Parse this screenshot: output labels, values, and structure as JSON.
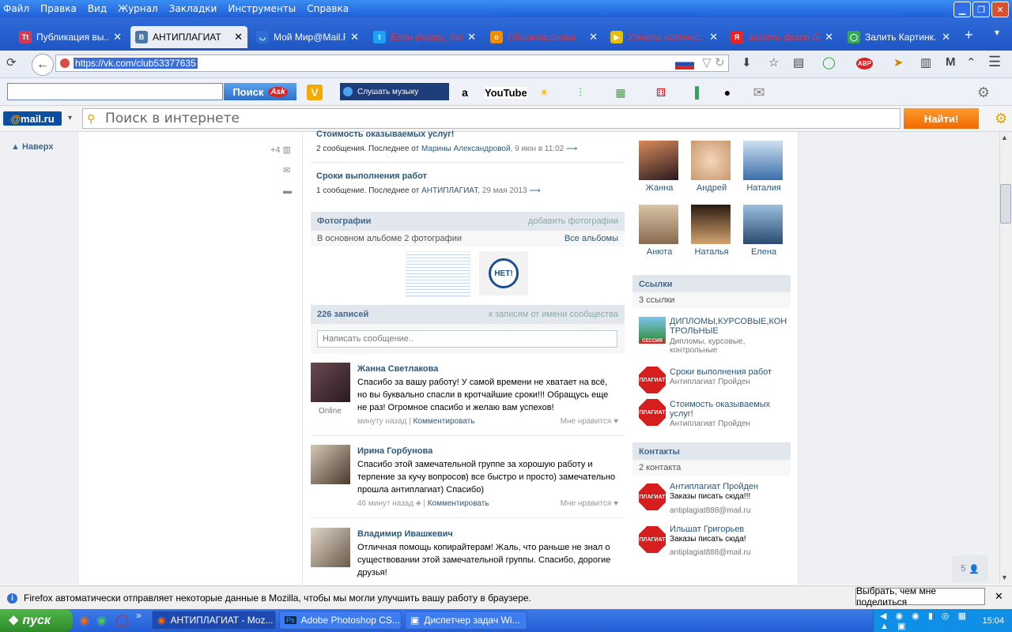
{
  "browser": {
    "menu": [
      "Файл",
      "Правка",
      "Вид",
      "Журнал",
      "Закладки",
      "Инструменты",
      "Справка"
    ],
    "tabs": [
      {
        "label": "Публикация вы...",
        "fav_text": "Tt",
        "fav_color": "#d43a5a",
        "active": false,
        "red": false
      },
      {
        "label": "АНТИПЛАГИАТ",
        "fav_text": "В",
        "fav_color": "#4a76a8",
        "active": true,
        "red": false
      },
      {
        "label": "Мой Мир@Mail.Ru",
        "fav_text": "◡",
        "fav_color": "#2a6fd1",
        "active": false,
        "red": false
      },
      {
        "label": "Елен (happy_mu...",
        "fav_text": "t",
        "fav_color": "#1da1f2",
        "active": false,
        "red": true
      },
      {
        "label": "Одноклассники",
        "fav_text": "о",
        "fav_color": "#f28b00",
        "active": false,
        "red": true
      },
      {
        "label": "Узнать количес...",
        "fav_text": "▶",
        "fav_color": "#e6c000",
        "active": false,
        "red": true
      },
      {
        "label": "залить фото бе...",
        "fav_text": "Я",
        "fav_color": "#e82525",
        "active": false,
        "red": true
      },
      {
        "label": "Залить Картинк...",
        "fav_text": "◯",
        "fav_color": "#34a853",
        "active": false,
        "red": false
      }
    ],
    "url": "https://vk.com/club53377635",
    "ask_button": "Поиск",
    "ask_logo": "Ask",
    "music_button": "Слушать музыку",
    "youtube": "YouTube",
    "mailru_logo": "mail.ru",
    "mailru_at": "@",
    "mail_search_placeholder": "Поиск в интернете",
    "find_button": "Найти!"
  },
  "page": {
    "back_to_top": "Наверх",
    "plus_count": "+4",
    "topics": [
      {
        "title": "Стоимость оказываемых услуг!",
        "count": "2 сообщения. Последнее от",
        "author": "Марины Александровой",
        "date": ", 9 июн в 11:02"
      },
      {
        "title": "Сроки выполнения работ",
        "count": "1 сообщение. Последнее от",
        "author": "АНТИПЛАГИАТ",
        "date": ", 29 мая 2013"
      }
    ],
    "photos": {
      "header": "Фотографии",
      "add": "добавить фотографии",
      "album_text": "В основном альбоме 2 фотографии",
      "all_albums": "Все альбомы",
      "badge_text": "НЕТ!"
    },
    "wall": {
      "header": "226 записей",
      "to_community": "к записям от имени сообщества",
      "placeholder": "Написать сообщение.."
    },
    "posts": [
      {
        "name": "Жанна Светлакова",
        "text": "Спасибо за вашу работу! У самой времени не хватает на всё, но вы буквально спасли в кротчайшие сроки!!! Обращусь еще не раз! Огромное спасибо и желаю вам успехов!",
        "time": "минуту назад",
        "comment": "Комментировать",
        "like": "Мне нравится",
        "status": "Online",
        "ava_color": "#3a2a30"
      },
      {
        "name": "Ирина Горбунова",
        "text": "Спасибо этой замечательной группе за хорошую работу и терпение за кучу вопросов) все быстро и просто) замечательно прошла антиплагиат) Спасибо)",
        "time": "46 минут назад",
        "comment": "Комментировать",
        "like": "Мне нравится",
        "status": "",
        "ava_color": "#5b4a3e"
      },
      {
        "name": "Владимир Ивашкевич",
        "text": "Отличная помощь копирайтерам! Жаль, что раньше не знал о существовании этой замечательной группы. Спасибо, дорогие друзья!",
        "time": "",
        "comment": "",
        "like": "",
        "status": "",
        "ava_color": "#7a6a5a"
      }
    ],
    "members": [
      {
        "name": "Жанна",
        "color": "#4d3b3f"
      },
      {
        "name": "Андрей",
        "color": "#e8b890"
      },
      {
        "name": "Наталия",
        "color": "#6f9ac8"
      },
      {
        "name": "Анюта",
        "color": "#b09070"
      },
      {
        "name": "Наталья",
        "color": "#c4a070"
      },
      {
        "name": "Елена",
        "color": "#4a6fa0"
      }
    ],
    "links": {
      "header": "Ссылки",
      "count": "3 ссылки",
      "items": [
        {
          "title": "ДИПЛОМЫ,КУРСОВЫЕ,КОН ТРОЛЬНЫЕ",
          "desc": "Дипломы, курсовые, контрольные",
          "icon": "session"
        },
        {
          "title": "Сроки выполнения работ",
          "desc": "Антиплагиат Пройден",
          "icon": "stop"
        },
        {
          "title": "Стоимость оказываемых услуг!",
          "desc": "Антиплагиат Пройден",
          "icon": "stop"
        }
      ]
    },
    "contacts": {
      "header": "Контакты",
      "count": "2 контакта",
      "items": [
        {
          "name": "Антиплагиат Пройден",
          "role": "Заказы писать сюда!!!",
          "email": "antiplagiat888@mail.ru"
        },
        {
          "name": "Ильшат Григорьев",
          "role": "Заказы писать сюда!",
          "email": "antiplagiat888@mail.ru"
        }
      ]
    },
    "stop_text": "ПЛАГИАТ",
    "session_text": "СЕССИЯ",
    "online_count": "5"
  },
  "notification": {
    "text": "Firefox автоматически отправляет некоторые данные в Mozilla, чтобы мы могли улучшить вашу работу в браузере.",
    "button": "Выбрать, чем мне поделиться"
  },
  "taskbar": {
    "start": "пуск",
    "tasks": [
      {
        "label": "АНТИПЛАГИАТ - Moz...",
        "active": true
      },
      {
        "label": "Adobe Photoshop CS...",
        "active": false
      },
      {
        "label": "Диспетчер задач Wi...",
        "active": false
      }
    ],
    "clock": "15:04"
  }
}
